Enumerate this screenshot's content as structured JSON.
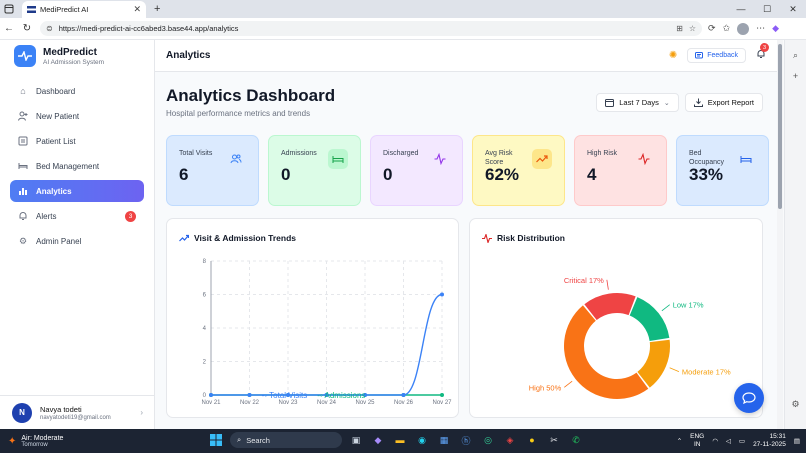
{
  "browser": {
    "tab_title": "MediPredict AI",
    "url": "https://medi-predict-ai-cc6abed3.base44.app/analytics"
  },
  "sidebar": {
    "brand": "MedPredict",
    "brand_sub": "AI Admission System",
    "items": [
      {
        "label": "Dashboard",
        "icon": "home-icon"
      },
      {
        "label": "New Patient",
        "icon": "user-plus-icon"
      },
      {
        "label": "Patient List",
        "icon": "list-icon"
      },
      {
        "label": "Bed Management",
        "icon": "bed-icon"
      },
      {
        "label": "Analytics",
        "icon": "chart-icon",
        "active": true
      },
      {
        "label": "Alerts",
        "icon": "bell-icon",
        "badge": "3"
      },
      {
        "label": "Admin Panel",
        "icon": "gear-icon"
      }
    ],
    "user": {
      "initial": "N",
      "name": "Navya todeti",
      "email": "navyatodeti19@gmail.com"
    }
  },
  "topbar": {
    "title": "Analytics",
    "feedback": "Feedback",
    "notifications": "3"
  },
  "dashboard": {
    "title": "Analytics Dashboard",
    "subtitle": "Hospital performance metrics and trends",
    "range": "Last 7 Days",
    "export": "Export Report"
  },
  "stats": [
    {
      "label": "Total Visits",
      "value": "6",
      "color": "#3b82f6"
    },
    {
      "label": "Admissions",
      "value": "0",
      "color": "#16a34a"
    },
    {
      "label": "Discharged",
      "value": "0",
      "color": "#9333ea"
    },
    {
      "label": "Avg Risk Score",
      "value": "62%",
      "color": "#ea580c"
    },
    {
      "label": "High Risk",
      "value": "4",
      "color": "#dc2626"
    },
    {
      "label": "Bed Occupancy",
      "value": "33%",
      "color": "#2563eb"
    }
  ],
  "panels": {
    "trends": "Visit & Admission Trends",
    "risk": "Risk Distribution"
  },
  "chart_data": [
    {
      "type": "line",
      "title": "Visit & Admission Trends",
      "categories": [
        "Nov 21",
        "Nov 22",
        "Nov 23",
        "Nov 24",
        "Nov 25",
        "Nov 26",
        "Nov 27"
      ],
      "series": [
        {
          "name": "Total Visits",
          "values": [
            0,
            0,
            0,
            0,
            0,
            0,
            6
          ],
          "color": "#3b82f6"
        },
        {
          "name": "Admissions",
          "values": [
            0,
            0,
            0,
            0,
            0,
            0,
            0
          ],
          "color": "#10b981"
        }
      ],
      "yticks": [
        "0",
        "2",
        "4",
        "6",
        "8"
      ],
      "ylim": [
        0,
        8
      ],
      "grid": true,
      "legend": "bottom"
    },
    {
      "type": "pie",
      "title": "Risk Distribution",
      "donut": true,
      "slices": [
        {
          "label": "High 50%",
          "value": 50,
          "color": "#f97316"
        },
        {
          "label": "Critical 17%",
          "value": 17,
          "color": "#ef4444"
        },
        {
          "label": "Low 17%",
          "value": 17,
          "color": "#10b981"
        },
        {
          "label": "Moderate 17%",
          "value": 17,
          "color": "#f59e0b"
        }
      ]
    }
  ],
  "taskbar": {
    "weather_title": "Air: Moderate",
    "weather_sub": "Tomorrow",
    "search": "Search",
    "lang1": "ENG",
    "lang2": "IN",
    "time": "15:31",
    "date": "27-11-2025"
  }
}
